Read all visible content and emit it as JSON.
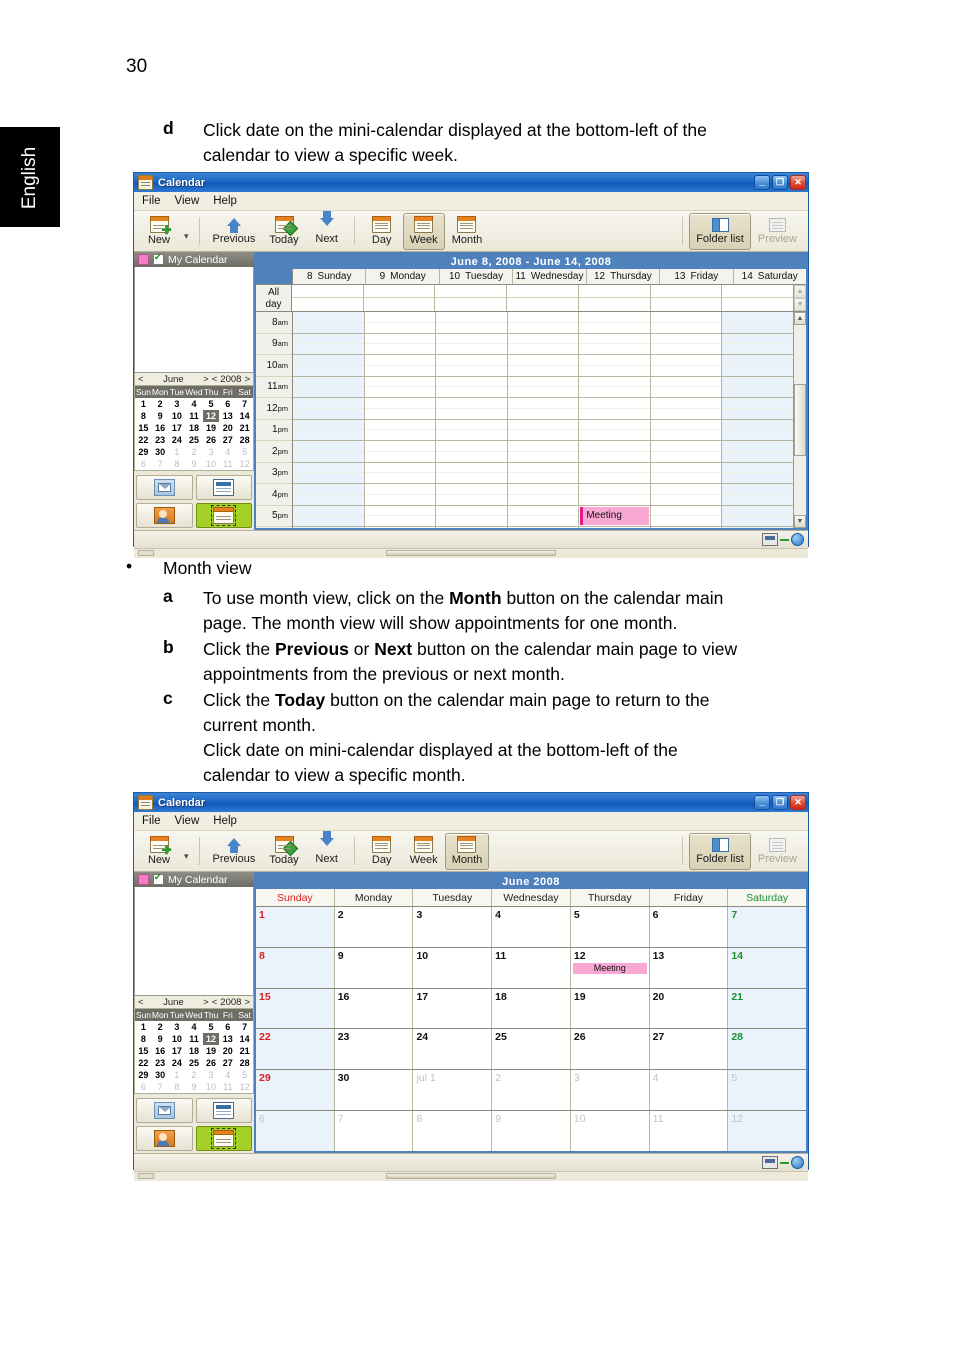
{
  "page": {
    "number": "30",
    "language_tab": "English"
  },
  "steps": {
    "d": {
      "marker": "d",
      "text_line1": "Click date on the mini-calendar displayed at the bottom-left of the",
      "text_line2": "calendar to view a specific week."
    },
    "month_view_bullet": "Month view",
    "a": {
      "marker": "a",
      "pre": "To use month view, click on the ",
      "bold": "Month",
      "post": " button on the calendar main",
      "line2": "page. The month view will show appointments for one month."
    },
    "b": {
      "marker": "b",
      "pre": "Click the ",
      "bold1": "Previous",
      "mid": " or ",
      "bold2": "Next",
      "post": " button on the calendar main page to view",
      "line2": "appointments from the previous or next month."
    },
    "c": {
      "marker": "c",
      "pre": "Click the ",
      "bold": "Today",
      "post": " button on the calendar main page to return to the",
      "line2": "current month.",
      "line3": "Click date on mini-calendar displayed at the bottom-left of the",
      "line4": "calendar to view a specific month."
    }
  },
  "window": {
    "title": "Calendar",
    "app_icon": "calendar-icon",
    "window_buttons": {
      "minimize": "_",
      "restore": "❐",
      "close": "✕"
    },
    "menus": [
      "File",
      "View",
      "Help"
    ],
    "toolbar": {
      "new": "New",
      "new_dropdown": "▾",
      "previous": "Previous",
      "today": "Today",
      "next": "Next",
      "day": "Day",
      "week": "Week",
      "month": "Month",
      "folder_list": "Folder list",
      "preview": "Preview"
    },
    "sidebar": {
      "calendar_name": "My Calendar",
      "calendar_color": "#f07ec0",
      "mini_nav": {
        "prev": "<",
        "month": "June",
        "next": ">",
        "year_prev": "<",
        "year": "2008",
        "year_next": ">"
      },
      "mini_weekdays": [
        "Sun",
        "Mon",
        "Tue",
        "Wed",
        "Thu",
        "Fri",
        "Sat"
      ],
      "mini_weeks": [
        [
          {
            "d": "1"
          },
          {
            "d": "2"
          },
          {
            "d": "3"
          },
          {
            "d": "4"
          },
          {
            "d": "5"
          },
          {
            "d": "6"
          },
          {
            "d": "7"
          }
        ],
        [
          {
            "d": "8"
          },
          {
            "d": "9"
          },
          {
            "d": "10"
          },
          {
            "d": "11"
          },
          {
            "d": "12",
            "sel": true
          },
          {
            "d": "13"
          },
          {
            "d": "14"
          }
        ],
        [
          {
            "d": "15"
          },
          {
            "d": "16"
          },
          {
            "d": "17"
          },
          {
            "d": "18"
          },
          {
            "d": "19"
          },
          {
            "d": "20"
          },
          {
            "d": "21"
          }
        ],
        [
          {
            "d": "22"
          },
          {
            "d": "23"
          },
          {
            "d": "24"
          },
          {
            "d": "25"
          },
          {
            "d": "26"
          },
          {
            "d": "27"
          },
          {
            "d": "28"
          }
        ],
        [
          {
            "d": "29"
          },
          {
            "d": "30"
          },
          {
            "d": "1",
            "out": true
          },
          {
            "d": "2",
            "out": true
          },
          {
            "d": "3",
            "out": true
          },
          {
            "d": "4",
            "out": true
          },
          {
            "d": "5",
            "out": true
          }
        ],
        [
          {
            "d": "6",
            "out": true
          },
          {
            "d": "7",
            "out": true
          },
          {
            "d": "8",
            "out": true
          },
          {
            "d": "9",
            "out": true
          },
          {
            "d": "10",
            "out": true
          },
          {
            "d": "11",
            "out": true
          },
          {
            "d": "12",
            "out": true
          }
        ]
      ],
      "shortcuts": [
        {
          "name": "mail-shortcut",
          "icon": "mail-icon",
          "selected": false
        },
        {
          "name": "news-shortcut",
          "icon": "news-icon",
          "selected": false
        },
        {
          "name": "contacts-shortcut",
          "icon": "contacts-icon",
          "selected": false
        },
        {
          "name": "calendar-shortcut",
          "icon": "calendar-icon",
          "selected": true
        }
      ]
    }
  },
  "week_view": {
    "active_toolbar_button": "Week",
    "range_title": "June  8, 2008  -  June  14, 2008",
    "all_day_label_line1": "All",
    "all_day_label_line2": "day",
    "day_headers": [
      {
        "num": "8",
        "name": "Sunday",
        "weekend": true
      },
      {
        "num": "9",
        "name": "Monday",
        "weekend": false
      },
      {
        "num": "10",
        "name": "Tuesday",
        "weekend": false
      },
      {
        "num": "11",
        "name": "Wednesday",
        "weekend": false
      },
      {
        "num": "12",
        "name": "Thursday",
        "weekend": false
      },
      {
        "num": "13",
        "name": "Friday",
        "weekend": false
      },
      {
        "num": "14",
        "name": "Saturday",
        "weekend": true
      }
    ],
    "time_slots": [
      {
        "h": "8",
        "m": "am"
      },
      {
        "h": "9",
        "m": "am"
      },
      {
        "h": "10",
        "m": "am"
      },
      {
        "h": "11",
        "m": "am"
      },
      {
        "h": "12",
        "m": "pm"
      },
      {
        "h": "1",
        "m": "pm"
      },
      {
        "h": "2",
        "m": "pm"
      },
      {
        "h": "3",
        "m": "pm"
      },
      {
        "h": "4",
        "m": "pm"
      },
      {
        "h": "5",
        "m": "pm"
      }
    ],
    "appointment": {
      "title": "Meeting",
      "day_index": 4,
      "slot_index": 9,
      "color": "#f9a8d4",
      "accent": "#e6198c"
    }
  },
  "month_view": {
    "active_toolbar_button": "Month",
    "range_title": "June   2008",
    "day_headers": [
      "Sunday",
      "Monday",
      "Tuesday",
      "Wednesday",
      "Thursday",
      "Friday",
      "Saturday"
    ],
    "weeks": [
      [
        {
          "n": "1"
        },
        {
          "n": "2"
        },
        {
          "n": "3"
        },
        {
          "n": "4"
        },
        {
          "n": "5"
        },
        {
          "n": "6"
        },
        {
          "n": "7"
        }
      ],
      [
        {
          "n": "8"
        },
        {
          "n": "9"
        },
        {
          "n": "10"
        },
        {
          "n": "11"
        },
        {
          "n": "12",
          "appt": "Meeting"
        },
        {
          "n": "13"
        },
        {
          "n": "14"
        }
      ],
      [
        {
          "n": "15"
        },
        {
          "n": "16"
        },
        {
          "n": "17"
        },
        {
          "n": "18"
        },
        {
          "n": "19"
        },
        {
          "n": "20"
        },
        {
          "n": "21"
        }
      ],
      [
        {
          "n": "22"
        },
        {
          "n": "23"
        },
        {
          "n": "24"
        },
        {
          "n": "25"
        },
        {
          "n": "26"
        },
        {
          "n": "27"
        },
        {
          "n": "28"
        }
      ],
      [
        {
          "n": "29"
        },
        {
          "n": "30"
        },
        {
          "n": "jul  1",
          "out": true
        },
        {
          "n": "2",
          "out": true
        },
        {
          "n": "3",
          "out": true
        },
        {
          "n": "4",
          "out": true
        },
        {
          "n": "5",
          "out": true
        }
      ],
      [
        {
          "n": "6",
          "out": true
        },
        {
          "n": "7",
          "out": true
        },
        {
          "n": "8",
          "out": true
        },
        {
          "n": "9",
          "out": true
        },
        {
          "n": "10",
          "out": true
        },
        {
          "n": "11",
          "out": true
        },
        {
          "n": "12",
          "out": true
        }
      ]
    ]
  }
}
